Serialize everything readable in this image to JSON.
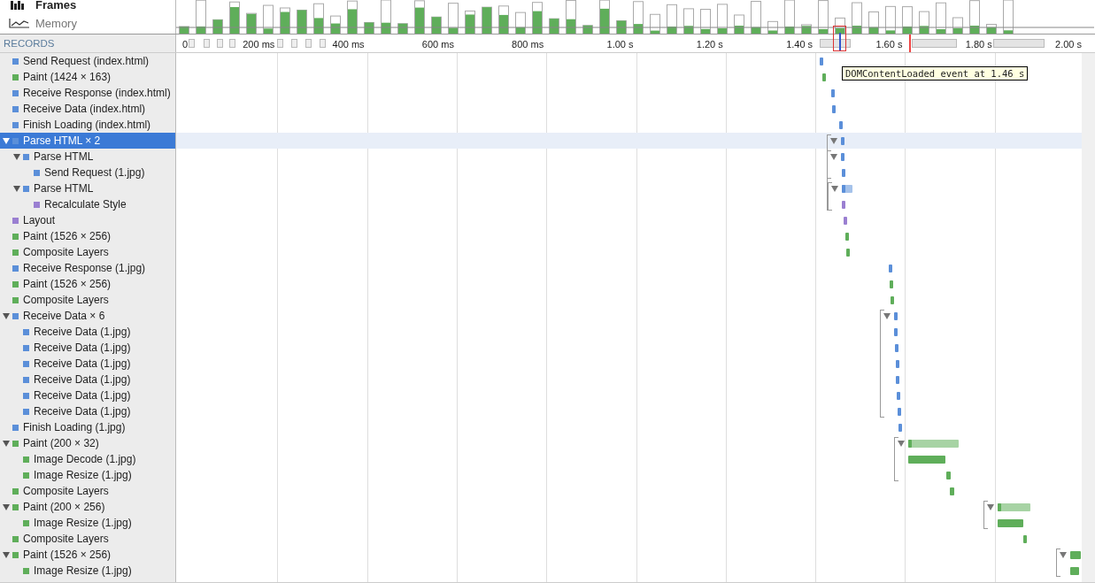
{
  "sidebar": {
    "views": [
      {
        "label": "Frames",
        "kind": "frames",
        "selected": true
      },
      {
        "label": "Memory",
        "kind": "memory",
        "selected": false
      }
    ]
  },
  "records_header": "RECORDS",
  "ruler": {
    "ticks": [
      "0",
      "200 ms",
      "400 ms",
      "600 ms",
      "800 ms",
      "1.00 s",
      "1.20 s",
      "1.40 s",
      "1.60 s",
      "1.80 s",
      "2.00 s"
    ]
  },
  "tooltip": "DOMContentLoaded event at 1.46 s",
  "records": [
    {
      "label": "Send Request (index.html)",
      "color": "#5b8fd9",
      "selected": false
    },
    {
      "label": "Paint (1424 × 163)",
      "color": "#5fae5a",
      "selected": false
    },
    {
      "label": "Receive Response (index.html)",
      "color": "#5b8fd9",
      "selected": false
    },
    {
      "label": "Receive Data (index.html)",
      "color": "#5b8fd9",
      "selected": false
    },
    {
      "label": "Finish Loading (index.html)",
      "color": "#5b8fd9",
      "selected": false
    },
    {
      "label": "Parse HTML × 2",
      "color": "#5b8fd9",
      "selected": true,
      "expanded": true,
      "children": [
        {
          "label": "Parse HTML",
          "color": "#5b8fd9",
          "selected": false,
          "expanded": true,
          "children": [
            {
              "label": "Send Request (1.jpg)",
              "color": "#5b8fd9",
              "selected": false
            }
          ]
        },
        {
          "label": "Parse HTML",
          "color": "#5b8fd9",
          "selected": false,
          "expanded": true,
          "children": [
            {
              "label": "Recalculate Style",
              "color": "#9a7fd1",
              "selected": false
            }
          ]
        }
      ]
    },
    {
      "label": "Layout",
      "color": "#9a7fd1",
      "selected": false
    },
    {
      "label": "Paint (1526 × 256)",
      "color": "#5fae5a",
      "selected": false
    },
    {
      "label": "Composite Layers",
      "color": "#5fae5a",
      "selected": false
    },
    {
      "label": "Receive Response (1.jpg)",
      "color": "#5b8fd9",
      "selected": false
    },
    {
      "label": "Paint (1526 × 256)",
      "color": "#5fae5a",
      "selected": false
    },
    {
      "label": "Composite Layers",
      "color": "#5fae5a",
      "selected": false
    },
    {
      "label": "Receive Data × 6",
      "color": "#5b8fd9",
      "selected": false,
      "expanded": true,
      "children": [
        {
          "label": "Receive Data (1.jpg)",
          "color": "#5b8fd9",
          "selected": false
        },
        {
          "label": "Receive Data (1.jpg)",
          "color": "#5b8fd9",
          "selected": false
        },
        {
          "label": "Receive Data (1.jpg)",
          "color": "#5b8fd9",
          "selected": false
        },
        {
          "label": "Receive Data (1.jpg)",
          "color": "#5b8fd9",
          "selected": false
        },
        {
          "label": "Receive Data (1.jpg)",
          "color": "#5b8fd9",
          "selected": false
        },
        {
          "label": "Receive Data (1.jpg)",
          "color": "#5b8fd9",
          "selected": false
        }
      ]
    },
    {
      "label": "Finish Loading (1.jpg)",
      "color": "#5b8fd9",
      "selected": false
    },
    {
      "label": "Paint (200 × 32)",
      "color": "#5fae5a",
      "selected": false,
      "expanded": true,
      "children": [
        {
          "label": "Image Decode (1.jpg)",
          "color": "#5fae5a",
          "selected": false
        },
        {
          "label": "Image Resize (1.jpg)",
          "color": "#5fae5a",
          "selected": false
        }
      ]
    },
    {
      "label": "Composite Layers",
      "color": "#5fae5a",
      "selected": false
    },
    {
      "label": "Paint (200 × 256)",
      "color": "#5fae5a",
      "selected": false,
      "expanded": true,
      "children": [
        {
          "label": "Image Resize (1.jpg)",
          "color": "#5fae5a",
          "selected": false
        }
      ]
    },
    {
      "label": "Composite Layers",
      "color": "#5fae5a",
      "selected": false
    },
    {
      "label": "Paint (1526 × 256)",
      "color": "#5fae5a",
      "selected": false,
      "expanded": true,
      "children": [
        {
          "label": "Image Resize (1.jpg)",
          "color": "#5fae5a",
          "selected": false
        }
      ]
    }
  ]
}
